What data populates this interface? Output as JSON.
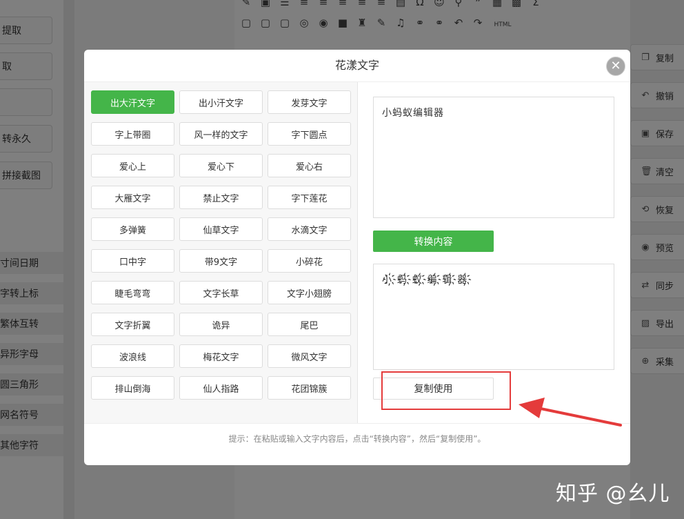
{
  "background": {
    "left_buttons": [
      "提取",
      "取",
      "",
      "转永久",
      "拼接截图"
    ],
    "left_list": [
      "寸间日期",
      "字转上标",
      "繁体互转",
      "异形字母",
      "圆三角形",
      "网名符号",
      "其他字符"
    ],
    "toolbar_row1": [
      "✎",
      "▣",
      "☰",
      "≡",
      "≡",
      "≡",
      "≡",
      "≡",
      "▤",
      "Ω",
      "☺",
      "⚲",
      "❞",
      "▦",
      "▩",
      "Σ"
    ],
    "toolbar_row2": [
      "▢",
      "▢",
      "▢",
      "◎",
      "◉",
      "■",
      "♜",
      "✎",
      "♫",
      "⚭",
      "⚭",
      "↶",
      "↷",
      "HTML"
    ],
    "right_buttons": [
      {
        "icon": "copy-icon",
        "glyph": "❐",
        "label": "复制"
      },
      {
        "icon": "undo-icon",
        "glyph": "↶",
        "label": "撤销"
      },
      {
        "icon": "save-icon",
        "glyph": "▣",
        "label": "保存"
      },
      {
        "icon": "trash-icon",
        "glyph": "🗑",
        "label": "清空"
      },
      {
        "icon": "restore-icon",
        "glyph": "⟲",
        "label": "恢复"
      },
      {
        "icon": "eye-icon",
        "glyph": "◉",
        "label": "预览"
      },
      {
        "icon": "sync-icon",
        "glyph": "⇄",
        "label": "同步"
      },
      {
        "icon": "export-icon",
        "glyph": "▨",
        "label": "导出"
      },
      {
        "icon": "search-plus-icon",
        "glyph": "⊕",
        "label": "采集"
      }
    ]
  },
  "dialog": {
    "title": "花漾文字",
    "close_glyph": "✕",
    "styles": [
      "出大汗文字",
      "出小汗文字",
      "发芽文字",
      "字上带圈",
      "风一样的文字",
      "字下圆点",
      "爱心上",
      "爱心下",
      "爱心右",
      "大雁文字",
      "禁止文字",
      "字下莲花",
      "多弹簧",
      "仙草文字",
      "水滴文字",
      "口中字",
      "带9文字",
      "小碎花",
      "睫毛弯弯",
      "文字长草",
      "文字小翅膀",
      "文字折翼",
      "诡异",
      "尾巴",
      "波浪线",
      "梅花文字",
      "微风文字",
      "排山倒海",
      "仙人指路",
      "花团锦簇"
    ],
    "active_style_index": 0,
    "input_text": "小蚂蚁编辑器",
    "convert_label": "转换内容",
    "output_text": "小҉蚂҉蚁҉编҉辑҉器҉",
    "copy_label": "复制使用",
    "tip": "提示：在粘贴或输入文字内容后，点击“转换内容”，然后“复制使用”。"
  },
  "watermark": "知乎 @幺儿"
}
